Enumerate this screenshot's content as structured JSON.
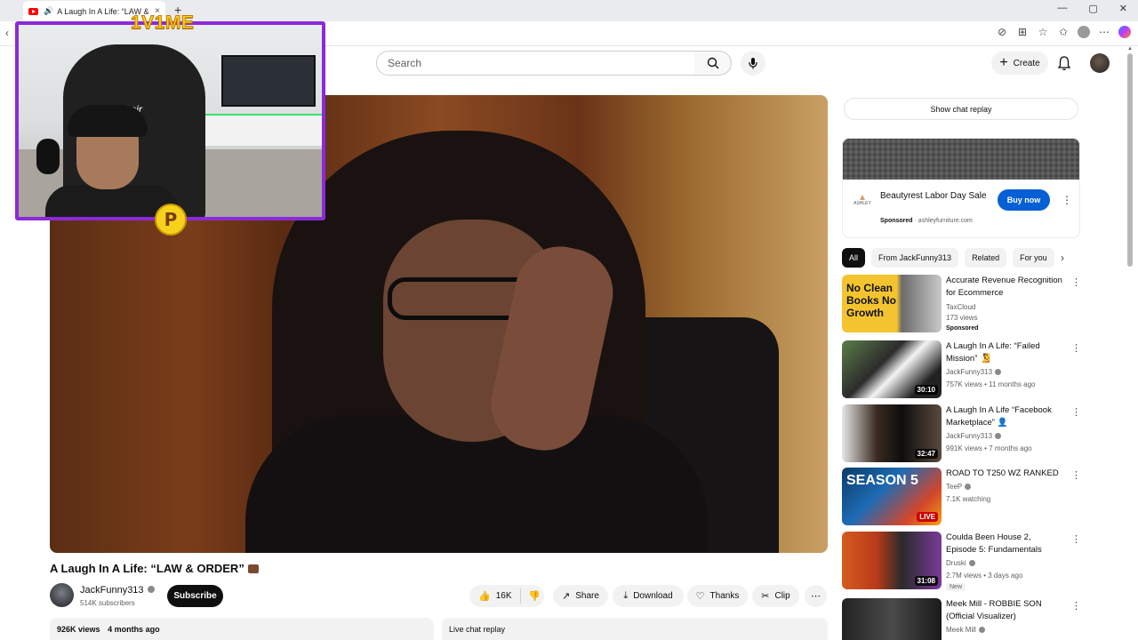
{
  "browser": {
    "tab_title": "A Laugh In A Life: “LAW & O",
    "new_tab": "+",
    "tab_close": "×",
    "minimize": "—",
    "maximize": "▢",
    "close": "✕"
  },
  "stream_overlay": {
    "title": "1V1ME",
    "badge_letter": "P",
    "chair_brand": "Zipchair"
  },
  "youtube": {
    "search_placeholder": "Search",
    "create_label": "Create"
  },
  "video": {
    "title": "A Laugh In A Life: “LAW & ORDER”",
    "channel": "JackFunny313",
    "subscribers": "514K subscribers",
    "subscribe_label": "Subscribe",
    "likes": "16K",
    "share_label": "Share",
    "download_label": "Download",
    "thanks_label": "Thanks",
    "clip_label": "Clip",
    "views": "926K views",
    "posted": "4 months ago",
    "live_chat_label": "Live chat replay"
  },
  "sidebar": {
    "chat_replay_button": "Show chat replay",
    "ad": {
      "title": "Beautyrest Labor Day Sale",
      "sponsored": "Sponsored",
      "domain": "ashleyfurniture.com",
      "cta": "Buy now",
      "logo_text": "ASHLEY"
    },
    "chips": [
      "All",
      "From JackFunny313",
      "Related",
      "For you"
    ],
    "recommendations": [
      {
        "title": "Accurate Revenue Recognition for Ecommerce",
        "channel": "TaxCloud",
        "stats": "173 views",
        "badge": "Sponsored",
        "thumb_text": "No Clean Books No Growth",
        "duration": ""
      },
      {
        "title": "A Laugh In A Life: “Failed Mission” 🧏",
        "channel": "JackFunny313",
        "stats": "757K views • 11 months ago",
        "badge": "",
        "duration": "30:10"
      },
      {
        "title": "A Laugh In A Life “Facebook Marketplace” 👤",
        "channel": "JackFunny313",
        "stats": "991K views • 7 months ago",
        "badge": "",
        "duration": "32:47"
      },
      {
        "title": "ROAD TO T250 WZ RANKED",
        "channel": "TeeP",
        "stats": "7.1K watching",
        "badge": "",
        "thumb_text": "SEASON 5",
        "live_label": "LIVE"
      },
      {
        "title": "Coulda Been House 2, Episode 5: Fundamentals",
        "channel": "Druski",
        "stats": "2.7M views • 3 days ago",
        "badge": "New",
        "duration": "31:08"
      },
      {
        "title": "Meek Mill - ROBBIE SON (Official Visualizer)",
        "channel": "Meek Mill",
        "stats": "",
        "badge": "",
        "duration": ""
      }
    ]
  }
}
